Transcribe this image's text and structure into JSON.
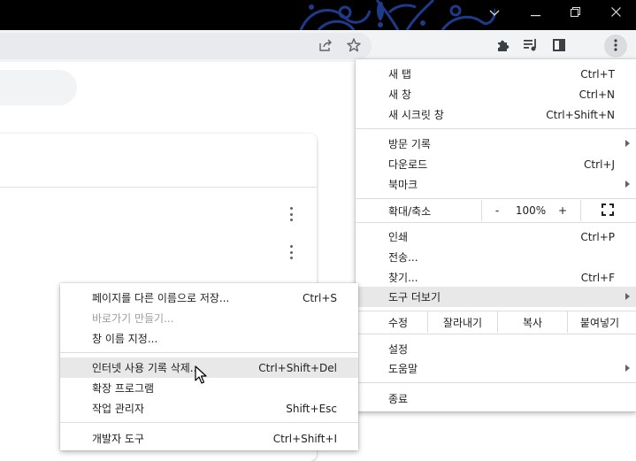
{
  "titlebar": {
    "icons": [
      "chevron-down-icon",
      "minimize-icon",
      "restore-icon",
      "close-icon"
    ]
  },
  "toolbar": {
    "icons": [
      "share-icon",
      "bookmark-star-icon",
      "extensions-icon",
      "media-control-icon",
      "side-panel-icon",
      "kebab-menu-icon"
    ]
  },
  "main_menu": {
    "new_tab": {
      "label": "새 탭",
      "shortcut": "Ctrl+T"
    },
    "new_window": {
      "label": "새 창",
      "shortcut": "Ctrl+N"
    },
    "incognito": {
      "label": "새 시크릿 창",
      "shortcut": "Ctrl+Shift+N"
    },
    "history": {
      "label": "방문 기록"
    },
    "downloads": {
      "label": "다운로드",
      "shortcut": "Ctrl+J"
    },
    "bookmarks": {
      "label": "북마크"
    },
    "zoom": {
      "label": "확대/축소",
      "minus": "-",
      "value": "100%",
      "plus": "+"
    },
    "print": {
      "label": "인쇄",
      "shortcut": "Ctrl+P"
    },
    "cast": {
      "label": "전송..."
    },
    "find": {
      "label": "찾기...",
      "shortcut": "Ctrl+F"
    },
    "more_tools": {
      "label": "도구 더보기"
    },
    "edit": {
      "label": "수정",
      "cut": "잘라내기",
      "copy": "복사",
      "paste": "붙여넣기"
    },
    "settings": {
      "label": "설정"
    },
    "help": {
      "label": "도움말"
    },
    "exit": {
      "label": "종료"
    }
  },
  "submenu": {
    "save_page": {
      "label": "페이지를 다른 이름으로 저장...",
      "shortcut": "Ctrl+S"
    },
    "create_shortcut": {
      "label": "바로가기 만들기..."
    },
    "name_window": {
      "label": "창 이름 지정..."
    },
    "clear_data": {
      "label": "인터넷 사용 기록 삭제...",
      "shortcut": "Ctrl+Shift+Del"
    },
    "extensions": {
      "label": "확장 프로그램"
    },
    "task_manager": {
      "label": "작업 관리자",
      "shortcut": "Shift+Esc"
    },
    "dev_tools": {
      "label": "개발자 도구",
      "shortcut": "Ctrl+Shift+I"
    }
  },
  "colors": {
    "titlebar": "#000000",
    "toolbar": "#f1f3f4",
    "highlight": "#e8e8e8",
    "pattern": "#1e3a8a"
  }
}
